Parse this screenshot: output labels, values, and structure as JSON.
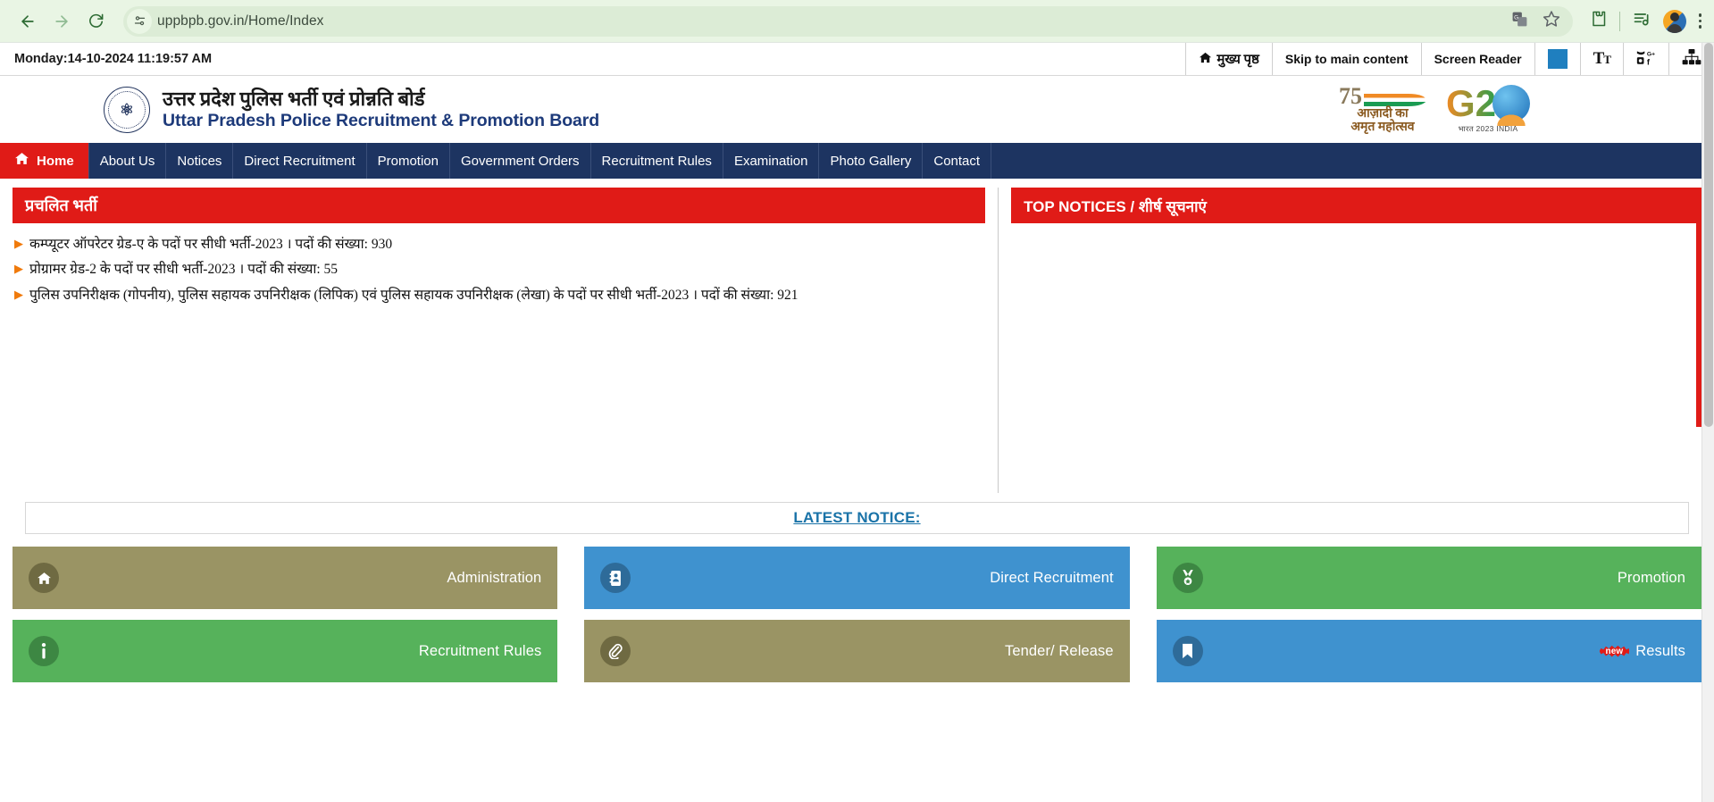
{
  "browser": {
    "url": "uppbpb.gov.in/Home/Index",
    "back_icon": "back-arrow-icon",
    "forward_icon": "forward-arrow-icon",
    "reload_icon": "reload-icon",
    "site_info_icon": "site-settings-icon",
    "translate_icon": "translate-icon",
    "bookmark_icon": "star-icon",
    "extensions_icon": "extensions-puzzle-icon",
    "media_icon": "media-list-icon",
    "profile_icon": "profile-avatar-icon",
    "menu_icon": "three-dot-menu-icon"
  },
  "utilbar": {
    "datetime": "Monday:14-10-2024 11:19:57 AM",
    "items": [
      {
        "label": "मुख्य पृष्ठ",
        "icon": "home-icon"
      },
      {
        "label": "Skip to main content",
        "icon": ""
      },
      {
        "label": "Screen Reader",
        "icon": ""
      }
    ],
    "color_swatch": "#1f7fbf",
    "text_size_label": "Tt",
    "social_icon": "social-media-icon",
    "sitemap_icon": "sitemap-icon"
  },
  "header": {
    "emblem_alt": "up-police-emblem",
    "title_hi": "उत्तर प्रदेश पुलिस भर्ती एवं प्रोन्नति बोर्ड",
    "title_en": "Uttar Pradesh Police Recruitment & Promotion Board",
    "azadi": {
      "num": "75",
      "line1": "आज़ादी का",
      "line2": "अमृत महोत्सव"
    },
    "g20": {
      "text": "G2",
      "caption": "भारत 2023 INDIA"
    }
  },
  "nav": {
    "items": [
      {
        "label": "Home",
        "active": true,
        "icon": "home-icon"
      },
      {
        "label": "About Us",
        "active": false
      },
      {
        "label": "Notices",
        "active": false
      },
      {
        "label": "Direct Recruitment",
        "active": false
      },
      {
        "label": "Promotion",
        "active": false
      },
      {
        "label": "Government Orders",
        "active": false
      },
      {
        "label": "Recruitment Rules",
        "active": false
      },
      {
        "label": "Examination",
        "active": false
      },
      {
        "label": "Photo Gallery",
        "active": false
      },
      {
        "label": "Contact",
        "active": false
      }
    ]
  },
  "panels": {
    "left_title": "प्रचलित भर्ती",
    "right_title": "TOP NOTICES / शीर्ष सूचनाएं",
    "notices": [
      "कम्प्यूटर ऑपरेटर ग्रेड-ए के पदों पर सीधी भर्ती-2023 । पदों की संख्या: 930",
      "प्रोग्रामर ग्रेड-2 के पदों पर सीधी भर्ती-2023 । पदों की संख्या: 55",
      "पुलिस उपनिरीक्षक (गोपनीय), पुलिस सहायक उपनिरीक्षक (लिपिक) एवं पुलिस सहायक उपनिरीक्षक (लेखा) के पदों पर सीधी भर्ती-2023 । पदों की संख्या: 921"
    ]
  },
  "latest": {
    "link_label": "LATEST NOTICE:"
  },
  "tiles": {
    "row1": [
      {
        "label": "Administration",
        "icon": "home-icon",
        "color": "khaki",
        "badge": ""
      },
      {
        "label": "Direct Recruitment",
        "icon": "address-book-icon",
        "color": "blue",
        "badge": ""
      },
      {
        "label": "Promotion",
        "icon": "medal-icon",
        "color": "green",
        "badge": ""
      }
    ],
    "row2": [
      {
        "label": "Recruitment Rules",
        "icon": "info-icon",
        "color": "green",
        "badge": ""
      },
      {
        "label": "Tender/ Release",
        "icon": "paperclip-icon",
        "color": "khaki",
        "badge": ""
      },
      {
        "label": "Results",
        "icon": "bookmark-icon",
        "color": "blue",
        "badge": "new"
      }
    ]
  },
  "colors": {
    "brand_navy": "#1d3461",
    "brand_red": "#e01b17",
    "accent_orange": "#f07a0c",
    "link_blue": "#1a73a8",
    "chrome_green": "#e9f5e4"
  }
}
